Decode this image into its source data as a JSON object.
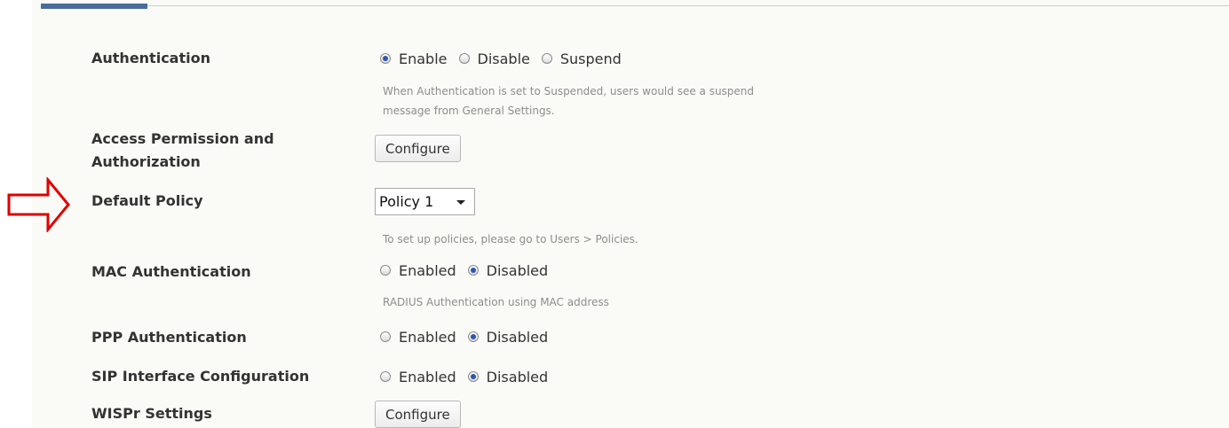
{
  "accent_color": "#4a6b9c",
  "arrow_color": "#e00000",
  "rows": {
    "authentication": {
      "label": "Authentication",
      "options": [
        "Enable",
        "Disable",
        "Suspend"
      ],
      "selected": "Enable",
      "hint_line1": "When Authentication is set to Suspended, users would see a suspend",
      "hint_line2": "message from General Settings."
    },
    "access_permission": {
      "label_line1": "Access Permission and",
      "label_line2": "Authorization",
      "button": "Configure"
    },
    "default_policy": {
      "label": "Default Policy",
      "selected": "Policy 1",
      "hint": "To set up policies, please go to Users > Policies."
    },
    "mac_authentication": {
      "label": "MAC Authentication",
      "options": [
        "Enabled",
        "Disabled"
      ],
      "selected": "Disabled",
      "hint": "RADIUS Authentication using MAC address"
    },
    "ppp_authentication": {
      "label": "PPP Authentication",
      "options": [
        "Enabled",
        "Disabled"
      ],
      "selected": "Disabled"
    },
    "sip_interface": {
      "label": "SIP Interface Configuration",
      "options": [
        "Enabled",
        "Disabled"
      ],
      "selected": "Disabled"
    },
    "wispr_settings": {
      "label": "WISPr Settings",
      "button": "Configure"
    }
  }
}
